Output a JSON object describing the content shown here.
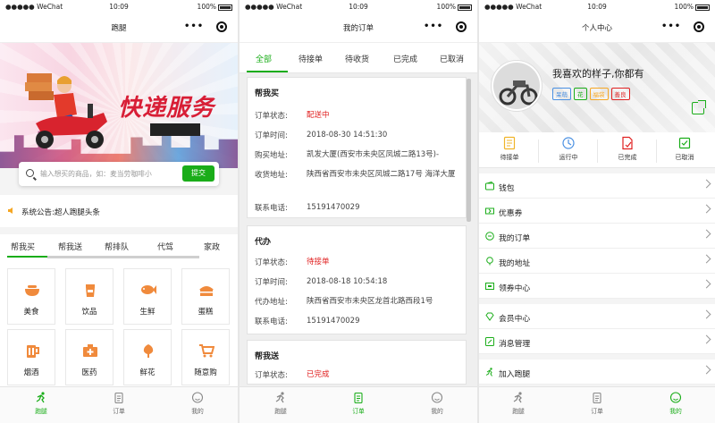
{
  "status": {
    "signal": "●●●●● WeChat",
    "time": "10:09",
    "battery": "100%"
  },
  "panel1": {
    "nav_title": "跑腿",
    "banner_title": "快递服务",
    "search_placeholder": "输入想买的商品，如：麦当劳咖啡小",
    "search_button": "提交",
    "notice": "系统公告:超人跑腿头条",
    "categories": [
      "帮我买",
      "帮我送",
      "帮排队",
      "代驾",
      "家政"
    ],
    "grid": [
      {
        "label": "美食",
        "icon": "food-bowl-icon"
      },
      {
        "label": "饮品",
        "icon": "drink-cup-icon"
      },
      {
        "label": "生鲜",
        "icon": "fish-icon"
      },
      {
        "label": "蛋糕",
        "icon": "cake-icon"
      },
      {
        "label": "烟酒",
        "icon": "beer-mug-icon"
      },
      {
        "label": "医药",
        "icon": "medicine-box-icon"
      },
      {
        "label": "鲜花",
        "icon": "flower-icon"
      },
      {
        "label": "随意购",
        "icon": "shopping-cart-icon"
      }
    ]
  },
  "tabbar": {
    "home": "跑腿",
    "orders": "订单",
    "me": "我的"
  },
  "panel2": {
    "nav_title": "我的订单",
    "tabs": [
      "全部",
      "待接单",
      "待收货",
      "已完成",
      "已取消"
    ],
    "orders": [
      {
        "type": "帮我买",
        "rows": [
          {
            "k": "订单状态:",
            "v": "配送中"
          },
          {
            "k": "订单时间:",
            "v": "2018-08-30 14:51:30"
          },
          {
            "k": "购买地址:",
            "v": "凯发大厦(西安市未央区凤城二路13号)-"
          },
          {
            "k": "收货地址:",
            "v": "陕西省西安市未央区凤城二路17号 海洋大厦"
          },
          {
            "k": "联系电话:",
            "v": "15191470029"
          }
        ]
      },
      {
        "type": "代办",
        "rows": [
          {
            "k": "订单状态:",
            "v": "待接单"
          },
          {
            "k": "订单时间:",
            "v": "2018-08-18 10:54:18"
          },
          {
            "k": "代办地址:",
            "v": "陕西省西安市未央区龙首北路西段1号"
          },
          {
            "k": "联系电话:",
            "v": "15191470029"
          }
        ]
      },
      {
        "type": "帮我送",
        "rows": [
          {
            "k": "订单状态:",
            "v": "已完成"
          }
        ]
      }
    ]
  },
  "panel3": {
    "nav_title": "个人中心",
    "user_name": "我喜欢的样子,你都有",
    "tags": [
      {
        "text": "呆萌",
        "color": "#4a90e2"
      },
      {
        "text": "花",
        "color": "#1aad19"
      },
      {
        "text": "福袋",
        "color": "#f5a623"
      },
      {
        "text": "善良",
        "color": "#e02020"
      }
    ],
    "order_stats": [
      "待接单",
      "运行中",
      "已完成",
      "已取消"
    ],
    "menu": [
      "钱包",
      "优惠券",
      "我的订单",
      "我的地址",
      "领券中心",
      "会员中心",
      "消息管理",
      "加入跑腿"
    ]
  },
  "colors": {
    "accent": "#1aad19",
    "alert": "#e02020"
  }
}
